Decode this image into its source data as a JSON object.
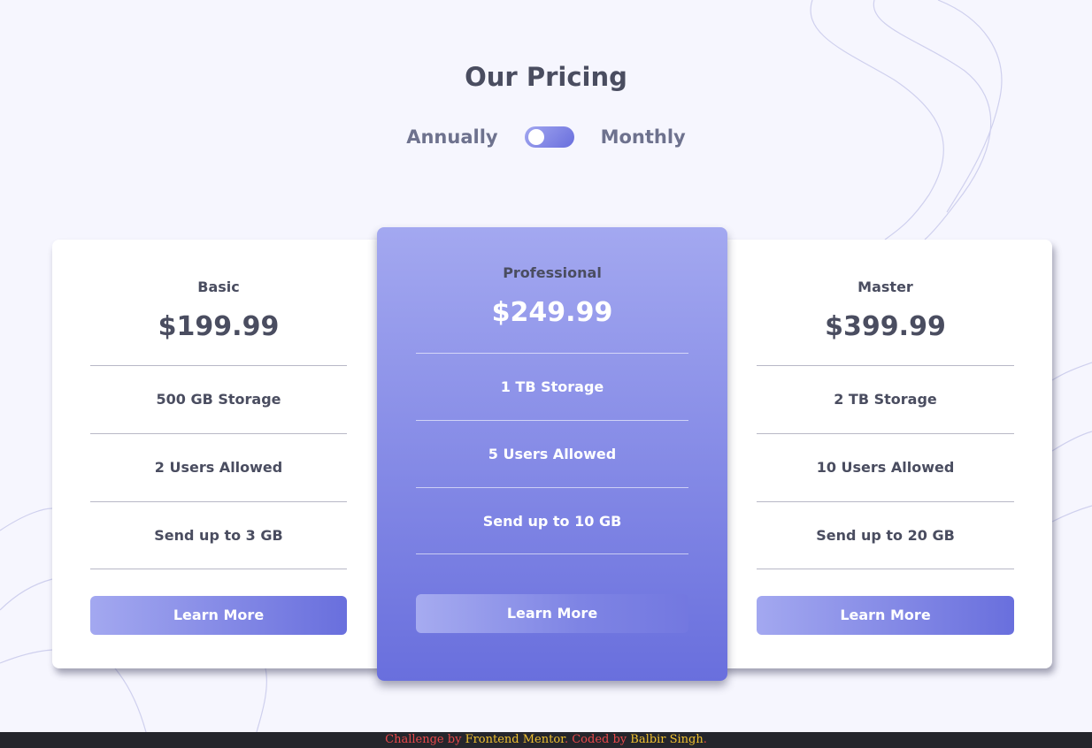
{
  "header": {
    "title": "Our Pricing"
  },
  "billing_toggle": {
    "left_label": "Annually",
    "right_label": "Monthly"
  },
  "plans": [
    {
      "name": "Basic",
      "price": "$199.99",
      "features": [
        "500 GB Storage",
        "2 Users Allowed",
        "Send up to 3 GB"
      ],
      "button_label": "Learn More"
    },
    {
      "name": "Professional",
      "price": "$249.99",
      "features": [
        "1 TB Storage",
        "5 Users Allowed",
        "Send up to 10 GB"
      ],
      "button_label": "Learn More"
    },
    {
      "name": "Master",
      "price": "$399.99",
      "features": [
        "2 TB Storage",
        "10 Users Allowed",
        "Send up to 20 GB"
      ],
      "button_label": "Learn More"
    }
  ],
  "footer": {
    "prefix": "Challenge by ",
    "link1": "Frontend Mentor",
    "middle": ". Coded by ",
    "link2": "Balbir Singh",
    "suffix": "."
  },
  "colors": {
    "background": "#f6f6fe",
    "accent_light": "#a3a8f0",
    "accent_dark": "#696fdd",
    "text_dark": "#4a4d60"
  }
}
